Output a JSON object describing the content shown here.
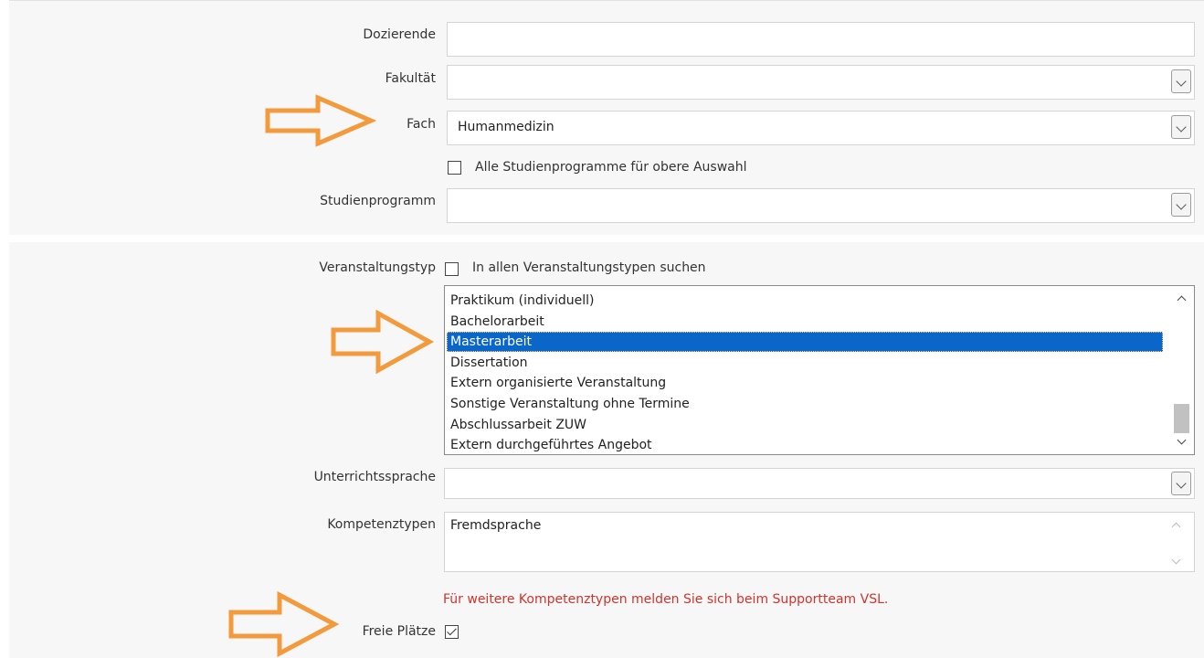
{
  "form": {
    "dozierende": {
      "label": "Dozierende",
      "value": ""
    },
    "fakultaet": {
      "label": "Fakultät",
      "value": ""
    },
    "fach": {
      "label": "Fach",
      "value": "Humanmedizin"
    },
    "alle_studienprogramme": {
      "label": "Alle Studienprogramme für obere Auswahl",
      "checked": false
    },
    "studienprogramm": {
      "label": "Studienprogramm",
      "value": ""
    },
    "veranstaltungstyp": {
      "label": "Veranstaltungstyp",
      "search_all_label": "In allen Veranstaltungstypen suchen",
      "search_all_checked": false,
      "options": [
        "Praktikum (individuell)",
        "Bachelorarbeit",
        "Masterarbeit",
        "Dissertation",
        "Extern organisierte Veranstaltung",
        "Sonstige Veranstaltung ohne Termine",
        "Abschlussarbeit ZUW",
        "Extern durchgeführtes Angebot"
      ],
      "selected": "Masterarbeit"
    },
    "unterrichtssprache": {
      "label": "Unterrichtssprache",
      "value": ""
    },
    "kompetenztypen": {
      "label": "Kompetenztypen",
      "value": "Fremdsprache"
    },
    "kompetenz_notice": "Für weitere Kompetenztypen melden Sie sich beim Supportteam VSL.",
    "freie_plaetze": {
      "label": "Freie Plätze",
      "checked": true
    }
  },
  "colors": {
    "annotation_arrow": "#f29a3c",
    "selection": "#0a66c8",
    "notice": "#d0342c",
    "panel": "#f7f7f7"
  }
}
